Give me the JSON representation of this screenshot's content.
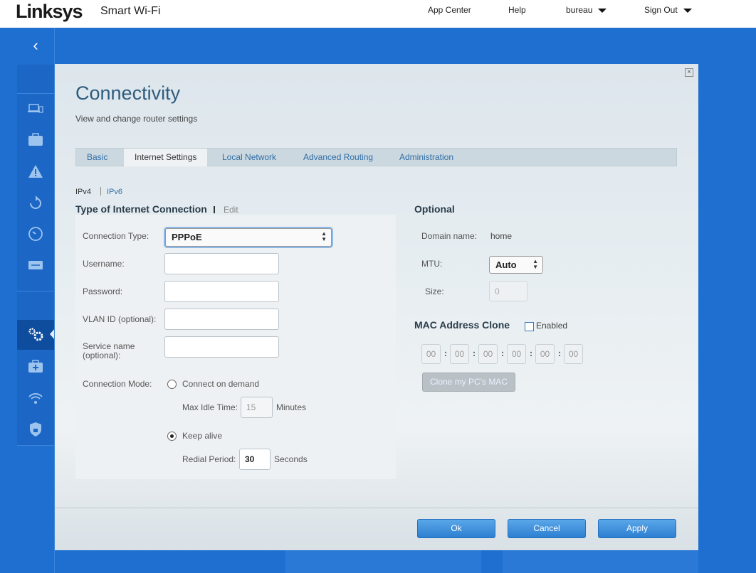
{
  "header": {
    "logo": "Linksys",
    "product": "Smart Wi-Fi",
    "nav": {
      "app_center": "App Center",
      "help": "Help",
      "user": "bureau",
      "sign_out": "Sign Out"
    }
  },
  "dialog": {
    "title": "Connectivity",
    "subtitle": "View and change router settings",
    "tabs": [
      {
        "label": "Basic"
      },
      {
        "label": "Internet Settings"
      },
      {
        "label": "Local Network"
      },
      {
        "label": "Advanced Routing"
      },
      {
        "label": "Administration"
      }
    ],
    "active_tab": "Internet Settings",
    "protocol": {
      "ipv4": "IPv4",
      "ipv6": "IPv6"
    },
    "connection": {
      "title": "Type of Internet Connection",
      "edit": "Edit",
      "connection_type_label": "Connection Type:",
      "connection_type_value": "PPPoE",
      "username_label": "Username:",
      "password_label": "Password:",
      "vlan_label": "VLAN ID (optional):",
      "service_label_1": "Service name",
      "service_label_2": "(optional):",
      "mode_label": "Connection Mode:",
      "connect_on_demand": "Connect on demand",
      "max_idle_label": "Max Idle Time:",
      "max_idle_value": "15",
      "minutes": "Minutes",
      "keep_alive": "Keep alive",
      "redial_label": "Redial Period:",
      "redial_value": "30",
      "seconds": "Seconds"
    },
    "optional": {
      "title": "Optional",
      "domain_label": "Domain name:",
      "domain_value": "home",
      "mtu_label": "MTU:",
      "mtu_value": "Auto",
      "size_label": "Size:",
      "size_value": "0"
    },
    "mac": {
      "title": "MAC Address Clone",
      "enabled_label": "Enabled",
      "octets": [
        "00",
        "00",
        "00",
        "00",
        "00",
        "00"
      ],
      "separator": ":",
      "clone_button": "Clone my PC's MAC"
    },
    "buttons": {
      "ok": "Ok",
      "cancel": "Cancel",
      "apply": "Apply"
    }
  },
  "colors": {
    "background": "#1e6fd0",
    "title": "#2e5c7e",
    "link": "#2f6ea5",
    "button": "#2d7fd1"
  }
}
